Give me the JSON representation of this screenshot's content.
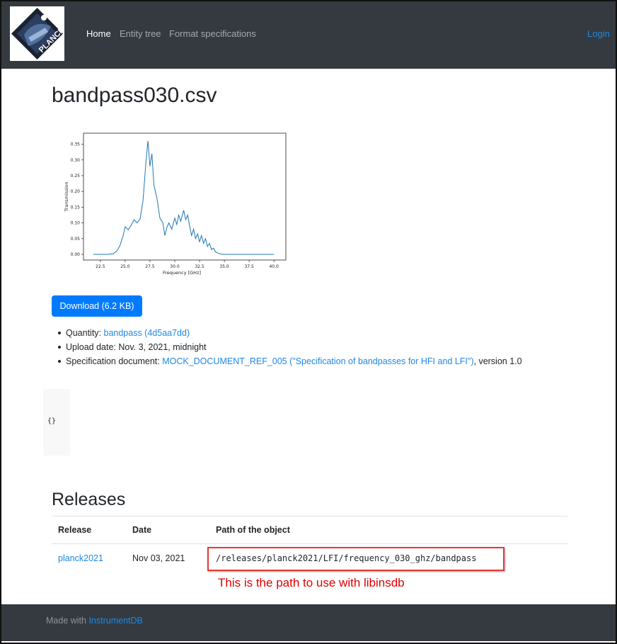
{
  "navbar": {
    "logo_text": "PLANCK",
    "logo_small_text": "esa",
    "links": [
      "Home",
      "Entity tree",
      "Format specifications"
    ],
    "login": "Login"
  },
  "page": {
    "title": "bandpass030.csv",
    "download_label": "Download (6.2 KB)",
    "meta": {
      "quantity_label": "Quantity: ",
      "quantity_link": "bandpass (4d5aa7dd)",
      "upload_label": "Upload date: ",
      "upload_value": "Nov. 3, 2021, midnight",
      "spec_label": "Specification document: ",
      "spec_link": "MOCK_DOCUMENT_REF_005 (\"Specification of bandpasses for HFI and LFI\")",
      "spec_suffix": ", version 1.0"
    },
    "json_content": "{}"
  },
  "chart_data": {
    "type": "line",
    "xlabel": "Frequency [GHz]",
    "ylabel": "Transmission",
    "xlim": [
      20.8,
      41.2
    ],
    "ylim": [
      -0.018,
      0.385
    ],
    "xticks": [
      "22.5",
      "25.0",
      "27.5",
      "30.0",
      "32.5",
      "35.0",
      "37.5",
      "40.0"
    ],
    "yticks": [
      "0.00",
      "0.05",
      "0.10",
      "0.15",
      "0.20",
      "0.25",
      "0.30",
      "0.35"
    ],
    "color": "#1f77b4",
    "x": [
      21.8,
      22.5,
      23.2,
      23.8,
      24.2,
      24.5,
      24.8,
      25.0,
      25.3,
      25.6,
      25.9,
      26.2,
      26.5,
      26.8,
      27.1,
      27.3,
      27.5,
      27.7,
      27.9,
      28.2,
      28.5,
      28.8,
      29.0,
      29.2,
      29.4,
      29.7,
      30.0,
      30.2,
      30.4,
      30.6,
      30.9,
      31.1,
      31.3,
      31.5,
      31.7,
      31.9,
      32.1,
      32.3,
      32.5,
      32.7,
      32.9,
      33.1,
      33.3,
      33.5,
      33.7,
      33.9,
      34.1,
      34.4,
      34.8,
      35.5,
      37.0,
      40.0
    ],
    "y": [
      0.0,
      0.0,
      0.0,
      0.002,
      0.012,
      0.03,
      0.06,
      0.088,
      0.078,
      0.092,
      0.11,
      0.1,
      0.112,
      0.17,
      0.295,
      0.36,
      0.28,
      0.32,
      0.22,
      0.18,
      0.115,
      0.1,
      0.06,
      0.085,
      0.1,
      0.08,
      0.115,
      0.095,
      0.125,
      0.105,
      0.14,
      0.11,
      0.125,
      0.09,
      0.06,
      0.08,
      0.05,
      0.065,
      0.04,
      0.06,
      0.035,
      0.05,
      0.025,
      0.035,
      0.015,
      0.02,
      0.008,
      0.003,
      0.0,
      0.0,
      0.0,
      0.0
    ]
  },
  "releases": {
    "title": "Releases",
    "headers": [
      "Release",
      "Date",
      "Path of the object"
    ],
    "rows": [
      {
        "release": "planck2021",
        "date": "Nov 03, 2021",
        "path": "/releases/planck2021/LFI/frequency_030_ghz/bandpass"
      }
    ],
    "annotation": "This is the path to use with libinsdb",
    "annotation_color": "#e00000"
  },
  "footer": {
    "prefix": "Made with ",
    "link": "InstrumentDB"
  }
}
